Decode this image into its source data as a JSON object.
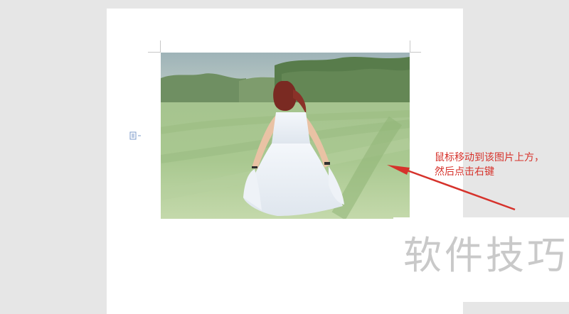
{
  "document": {
    "image_alt": "girl in white dress walking in green field"
  },
  "annotation": {
    "line1": "鼠标移动到该图片上方，",
    "line2": "然后点击右键",
    "color": "#d6322b"
  },
  "watermark": {
    "text": "软件技巧"
  },
  "icons": {
    "anchor": "paragraph-anchor-icon"
  }
}
